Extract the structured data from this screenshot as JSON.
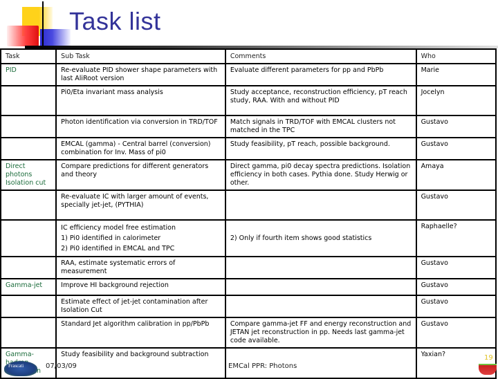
{
  "slide": {
    "title": "Task list",
    "footer": {
      "date": "07/03/09",
      "center_text": "EMCal PPR: Photons",
      "slide_number": "19",
      "left_logo_text": "Frascati"
    }
  },
  "table": {
    "headers": [
      "Task",
      "Sub Task",
      "Comments",
      "Who"
    ],
    "rows": [
      {
        "task": "PID",
        "subtask": "Re-evaluate PID shower shape parameters with last AliRoot version",
        "comments": "Evaluate different parameters for pp and PbPb",
        "who": "Marie"
      },
      {
        "task": "",
        "subtask": "Pi0/Eta invariant mass analysis",
        "comments": "Study acceptance, reconstruction efficiency, pT reach study, RAA. With and without PID",
        "who": "Jocelyn"
      },
      {
        "task": "",
        "subtask": "Photon identification via conversion in TRD/TOF",
        "comments": "Match signals in TRD/TOF with EMCAL clusters not matched in the TPC",
        "who": "Gustavo"
      },
      {
        "task": "",
        "subtask": "EMCAL (gamma) - Central barrel (conversion) combination for Inv. Mass of pi0",
        "comments": "Study feasibility, pT reach, possible background.",
        "who": "Gustavo"
      },
      {
        "task": "Direct photons Isolation cut",
        "subtask": "Compare predictions for different generators and theory",
        "comments": "Direct gamma, pi0 decay spectra predictions. Isolation efficiency in both cases. Pythia done. Study Herwig or other.",
        "who": "Amaya"
      },
      {
        "task": "",
        "subtask": "Re-evaluate IC with larger amount of events, specially jet-jet, (PYTHIA)",
        "comments": "",
        "who": "Gustavo"
      },
      {
        "task": "",
        "subtask_lines": [
          "IC efficiency model free estimation",
          "1) Pi0 identified in calorimeter",
          "2) Pi0 identified in EMCAL and TPC"
        ],
        "comments": "2) Only if fourth item shows good statistics",
        "who": "Raphaelle?"
      },
      {
        "task": "",
        "subtask": "RAA, estimate systematic errors of measurement",
        "comments": "",
        "who": "Gustavo"
      },
      {
        "task": "Gamma-jet",
        "subtask": "Improve HI background rejection",
        "comments": "",
        "who": "Gustavo"
      },
      {
        "task": "",
        "subtask": "Estimate effect of jet-jet contamination after Isolation Cut",
        "comments": "",
        "who": "Gustavo"
      },
      {
        "task": "",
        "subtask": "Standard Jet algorithm calibration in pp/PbPb",
        "comments": "Compare gamma-jet FF and energy reconstruction and JETAN jet reconstruction in pp. Needs last gamma-jet code available.",
        "who": "Gustavo"
      },
      {
        "task": "Gamma-hadron correlation",
        "subtask": "Study feasibility and background subtraction",
        "comments": "",
        "who": "Yaxian?"
      }
    ]
  },
  "colors": {
    "title": "#333399",
    "task_name": "#1a6b3a",
    "slide_number": "#e0c020"
  }
}
